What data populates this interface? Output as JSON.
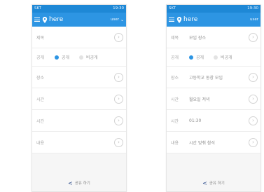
{
  "colors": {
    "appbar": "#2d95e3",
    "statusbar": "#1e88d6",
    "accent": "#2d95e3"
  },
  "phones": [
    {
      "status": {
        "left": "SKT",
        "right": "19:30"
      },
      "appbar": {
        "brand": "here",
        "user": "user"
      },
      "rows": [
        {
          "label": "제목",
          "value": ""
        },
        {
          "label": "공개",
          "opt_public": "공개",
          "opt_private": "비공개"
        },
        {
          "label": "장소",
          "value": ""
        },
        {
          "label": "시간",
          "value": ""
        },
        {
          "label": "시간",
          "value": ""
        },
        {
          "label": "내용",
          "value": ""
        }
      ],
      "footer": "공유 하기"
    },
    {
      "status": {
        "left": "SKT",
        "right": "19:30"
      },
      "appbar": {
        "brand": "here",
        "user": "user"
      },
      "rows": [
        {
          "label": "제목",
          "value": "모임 장소"
        },
        {
          "label": "공개",
          "opt_public": "공개",
          "opt_private": "비공개"
        },
        {
          "label": "장소",
          "value": "고등학교 동창 모임"
        },
        {
          "label": "시간",
          "value": "월요일 저녁"
        },
        {
          "label": "시간",
          "value": "01:30"
        },
        {
          "label": "내용",
          "value": "시간 맞춰 참석"
        }
      ],
      "footer": "공유 하기"
    }
  ]
}
